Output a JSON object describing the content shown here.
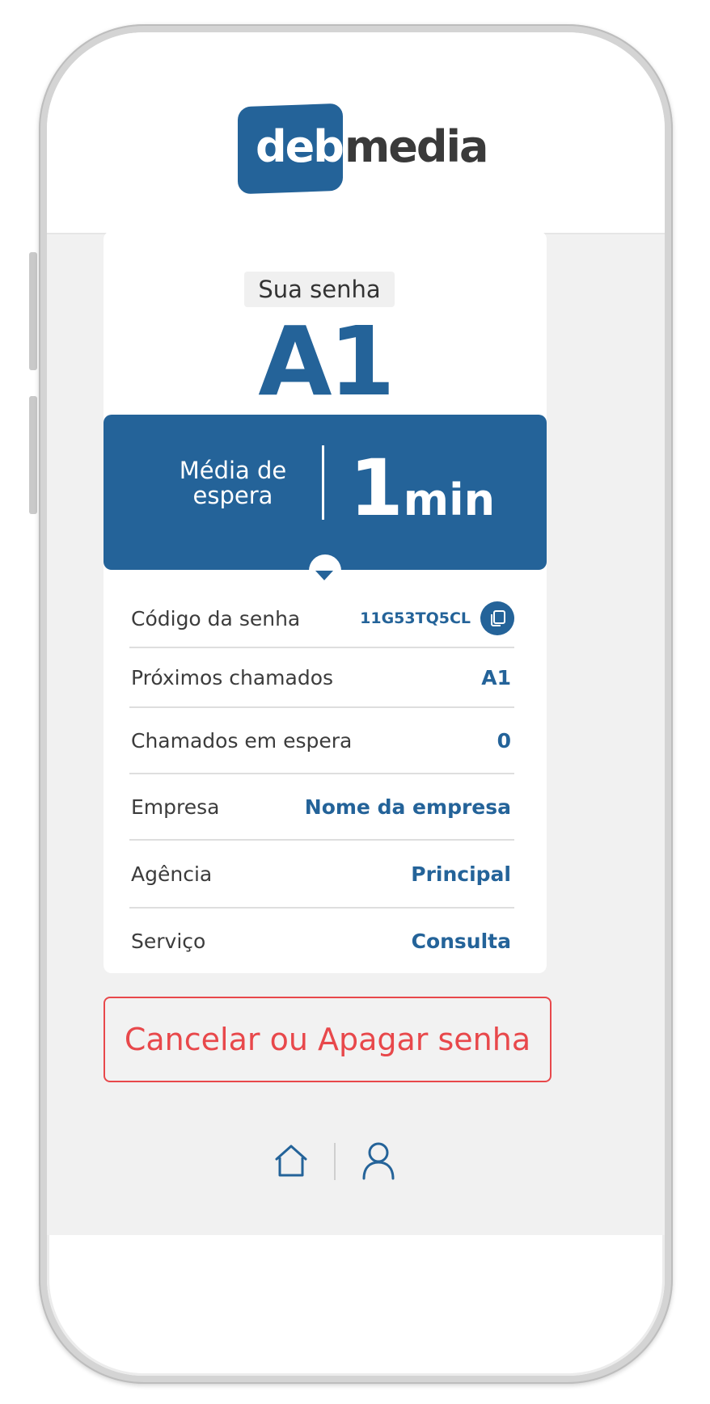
{
  "brand": {
    "part1": "deb",
    "part2": "media",
    "accent": "#246399"
  },
  "ticket": {
    "label": "Sua senha",
    "code": "A1"
  },
  "wait": {
    "label_line1": "Média de",
    "label_line2": "espera",
    "value": "1",
    "unit": "min"
  },
  "details": [
    {
      "label": "Código da senha",
      "value": "11G53TQ5CL"
    },
    {
      "label": "Próximos chamados",
      "value": "A1"
    },
    {
      "label": "Chamados em espera",
      "value": "0"
    },
    {
      "label": "Empresa",
      "value": "Nome da empresa"
    },
    {
      "label": "Agência",
      "value": "Principal"
    },
    {
      "label": "Serviço",
      "value": "Consulta"
    }
  ],
  "actions": {
    "cancel_label": "Cancelar ou Apagar senha",
    "cancel_color": "#e8484b"
  },
  "nav": {
    "home_icon": "home-icon",
    "user_icon": "user-icon"
  }
}
